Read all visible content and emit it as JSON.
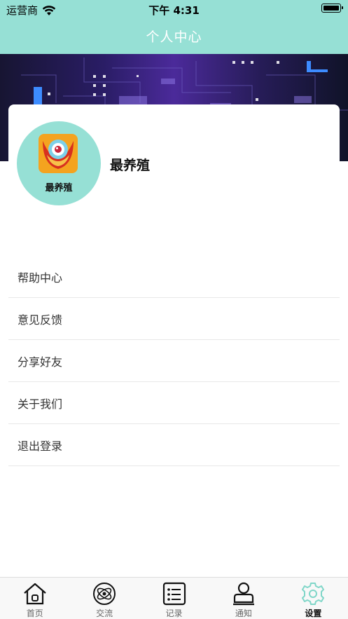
{
  "status_bar": {
    "carrier": "运营商",
    "time": "下午 4:31"
  },
  "header": {
    "title": "个人中心"
  },
  "profile": {
    "avatar_text": "最养殖",
    "username": "最养殖"
  },
  "menu": {
    "items": [
      {
        "label": "帮助中心"
      },
      {
        "label": "意见反馈"
      },
      {
        "label": "分享好友"
      },
      {
        "label": "关于我们"
      },
      {
        "label": "退出登录"
      }
    ]
  },
  "tabbar": {
    "items": [
      {
        "label": "首页",
        "icon": "home-icon"
      },
      {
        "label": "交流",
        "icon": "orbit-icon"
      },
      {
        "label": "记录",
        "icon": "list-icon"
      },
      {
        "label": "通知",
        "icon": "user-icon"
      },
      {
        "label": "设置",
        "icon": "gear-icon",
        "active": true
      }
    ]
  },
  "colors": {
    "accent": "#96e0d5",
    "active_tab_icon": "#7fd6c8"
  }
}
